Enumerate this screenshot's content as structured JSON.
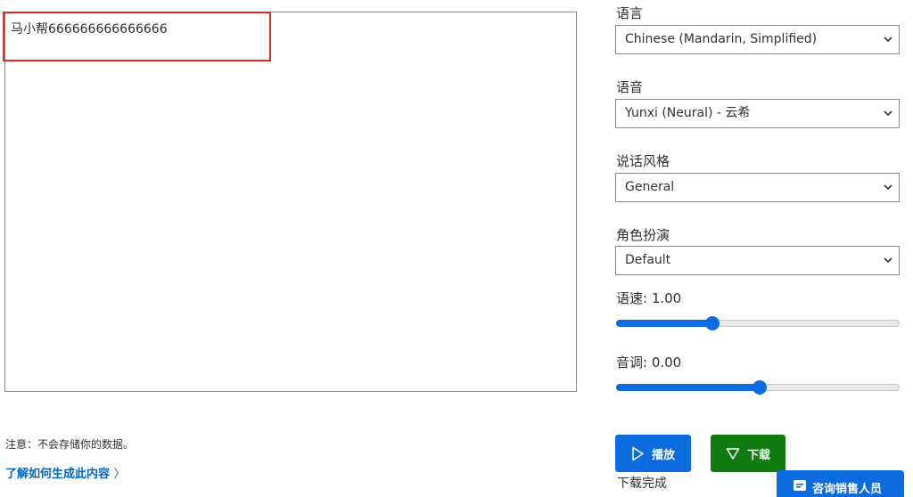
{
  "editor": {
    "text": "马小帮666666666666666"
  },
  "settings": {
    "language": {
      "label": "语言",
      "value": "Chinese (Mandarin, Simplified)"
    },
    "voice": {
      "label": "语音",
      "value": "Yunxi (Neural) - 云希"
    },
    "style": {
      "label": "说话风格",
      "value": "General"
    },
    "role": {
      "label": "角色扮演",
      "value": "Default"
    },
    "rate": {
      "label": "语速: 1.00",
      "fraction": 0.34
    },
    "pitch": {
      "label": "音调: 0.00",
      "fraction": 0.505
    }
  },
  "notice": {
    "text": "注意：不会存储你的数据。",
    "link": "了解如何生成此内容",
    "link_chevron": "〉"
  },
  "actions": {
    "play_label": "播放",
    "download_label": "下载",
    "status": "下载完成"
  },
  "chat": {
    "label": "咨询销售人员"
  },
  "colors": {
    "accent": "#0b6bdf",
    "download": "#107c10",
    "highlight": "#e3242b",
    "link": "#0067b8"
  },
  "icons": {
    "chevron": "chevron-down-icon",
    "play": "play-icon",
    "download": "download-icon",
    "chat": "chat-icon"
  }
}
